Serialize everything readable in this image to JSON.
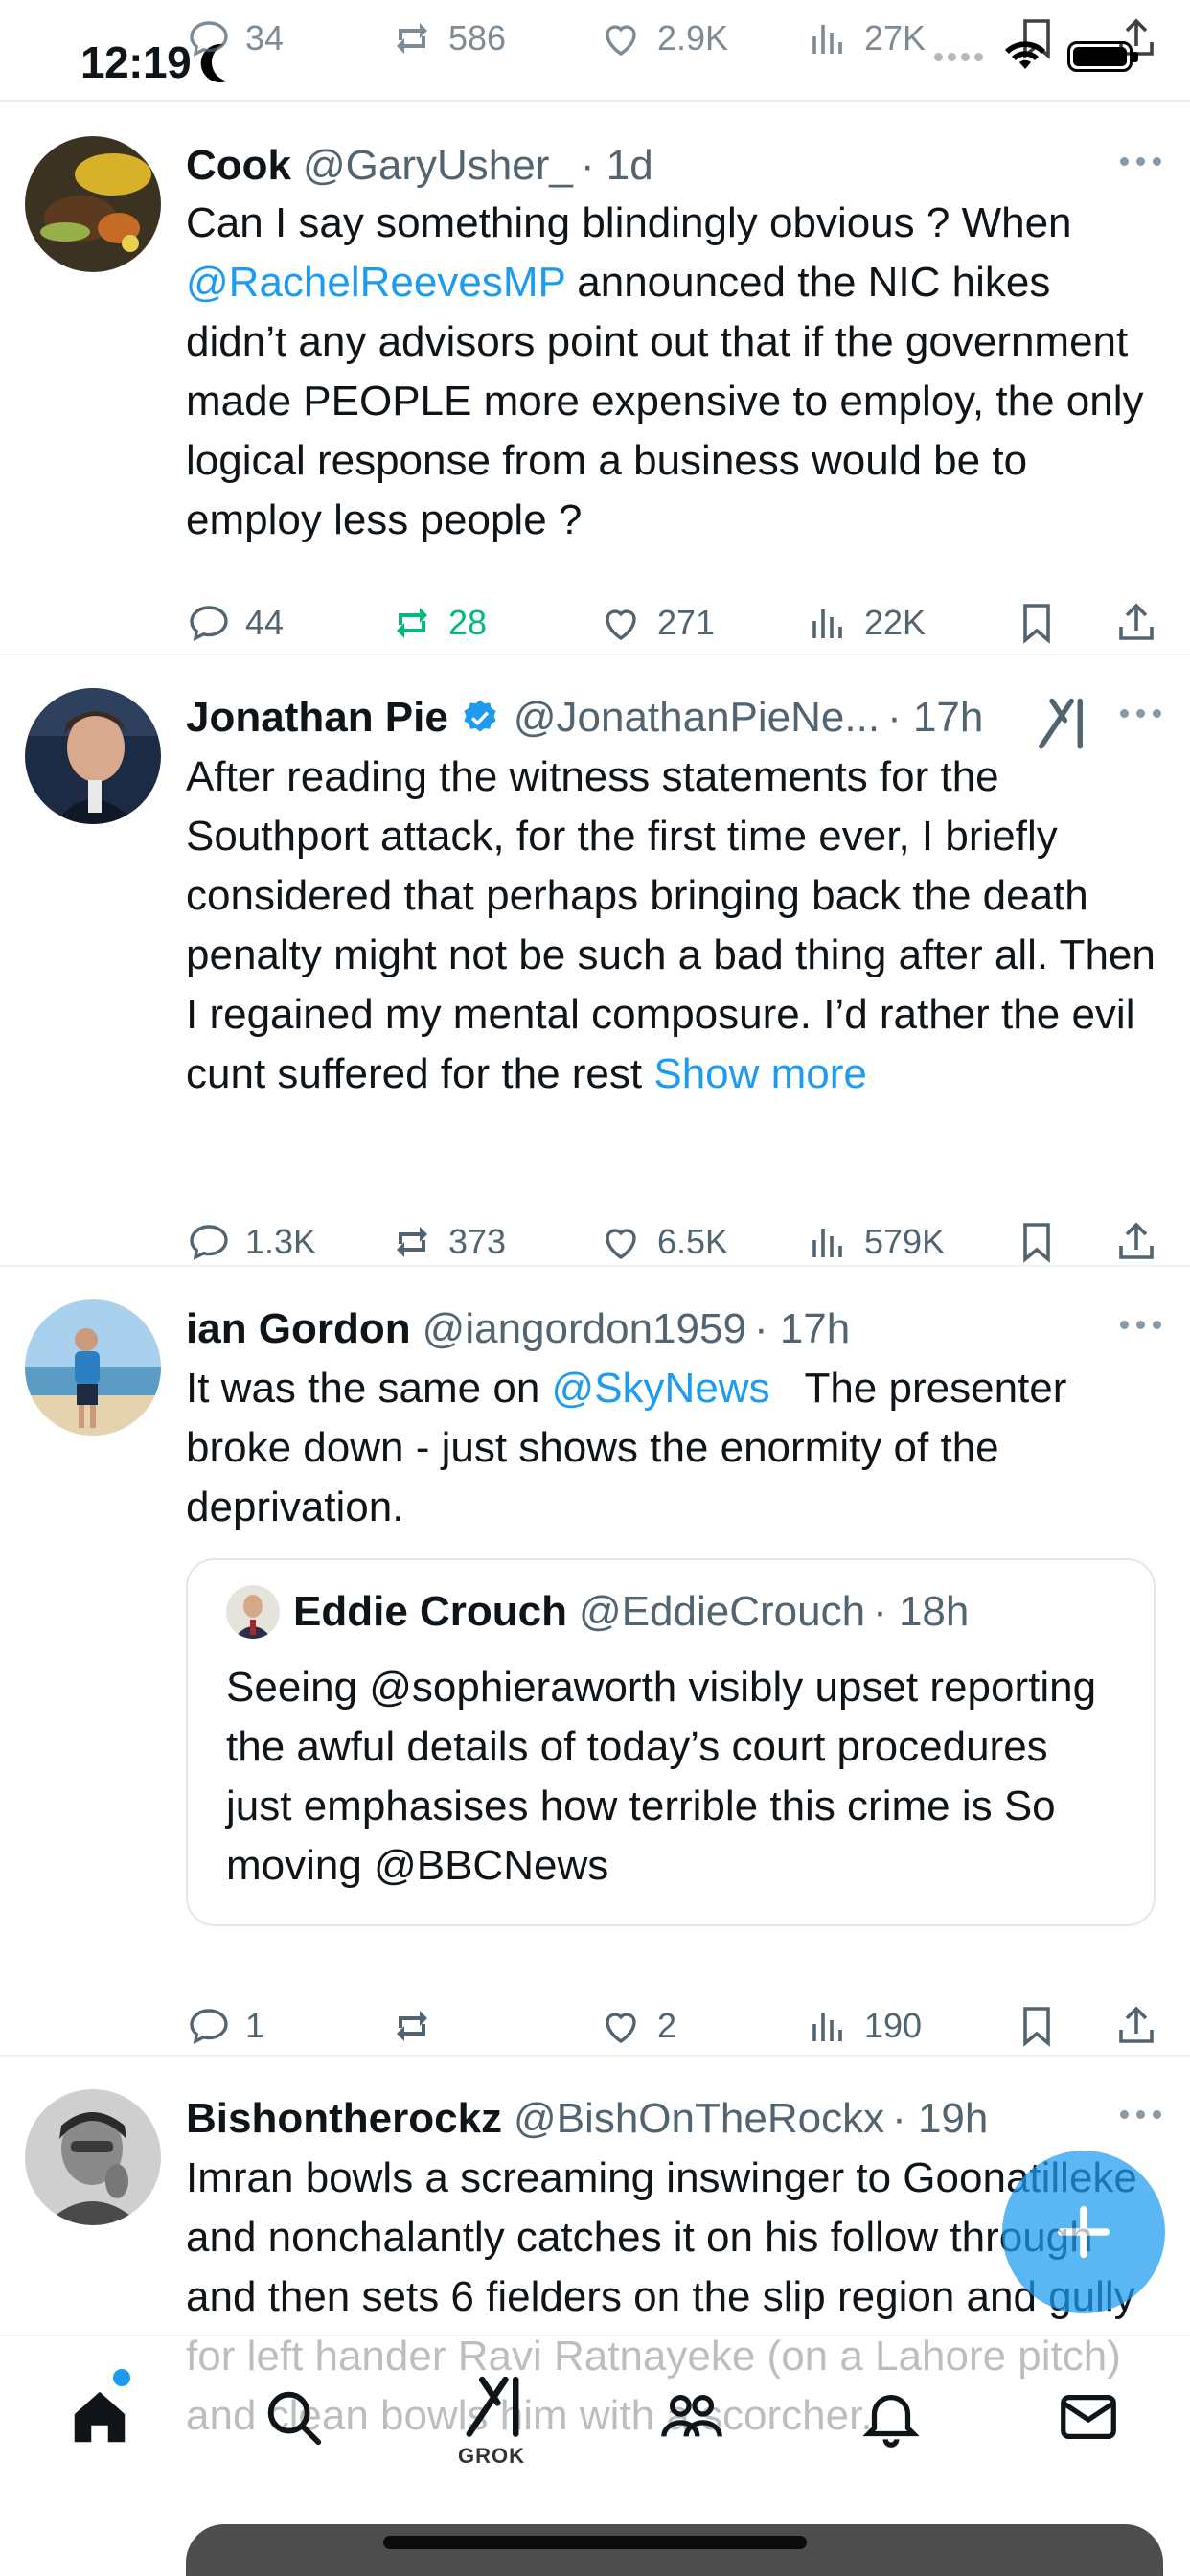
{
  "status_bar": {
    "time": "12:19"
  },
  "ghost_actions": {
    "replies": "34",
    "reposts": "586",
    "likes": "2.9K",
    "views": "27K"
  },
  "tweets": [
    {
      "name": "Cook",
      "handle": "@GaryUsher_",
      "time": "· 1d",
      "body_before": "Can I say something blindingly obvious ? When ",
      "mention": "@RachelReevesMP",
      "body_after": " announced the NIC hikes didn’t any advisors point out that if the government made PEOPLE more expensive to employ, the only logical response from a business would be to employ less people ?",
      "replies": "44",
      "reposts": "28",
      "likes": "271",
      "views": "22K"
    },
    {
      "name": "Jonathan Pie",
      "handle": "@JonathanPieNe...",
      "time": "· 17h",
      "body": "After reading the witness statements for the Southport attack, for the first time ever, I briefly considered that perhaps bringing back the death penalty might not be such a bad thing after all. Then I regained my mental composure. I’d rather the evil cunt suffered for the rest ",
      "show_more": "Show more",
      "replies": "1.3K",
      "reposts": "373",
      "likes": "6.5K",
      "views": "579K"
    },
    {
      "name": "ian Gordon",
      "handle": "@iangordon1959",
      "time": "· 17h",
      "body_before": "It was the same on ",
      "mention": "@SkyNews",
      "body_after": "   The presenter broke down - just shows the enormity of the deprivation.",
      "quote": {
        "name": "Eddie Crouch",
        "handle": "@EddieCrouch",
        "time": "· 18h",
        "body": "Seeing @sophieraworth visibly upset reporting the awful details of today’s court procedures just emphasises how terrible this crime is So moving  @BBCNews"
      },
      "replies": "1",
      "reposts": "",
      "likes": "2",
      "views": "190"
    },
    {
      "name": "Bishontherockz",
      "handle": "@BishOnTheRockx",
      "time": "· 19h",
      "body": "Imran bowls a screaming inswinger to Goonatilleke and nonchalantly catches it on his follow through and then sets 6 fielders on the slip region and gully for left hander Ravi Ratnayeke (on a Lahore pitch) and clean bowls him with a scorcher."
    }
  ],
  "bottom_nav": {
    "grok_label": "GROK"
  },
  "colors": {
    "accent": "#1d9bf0",
    "repost_active": "#00ba7c",
    "secondary_text": "#536471"
  },
  "icons": [
    "reply-icon",
    "repost-icon",
    "like-icon",
    "views-icon",
    "bookmark-icon",
    "share-icon",
    "more-icon",
    "verified-icon",
    "grok-icon",
    "home-icon",
    "search-icon",
    "communities-icon",
    "notifications-icon",
    "messages-icon",
    "compose-icon"
  ]
}
